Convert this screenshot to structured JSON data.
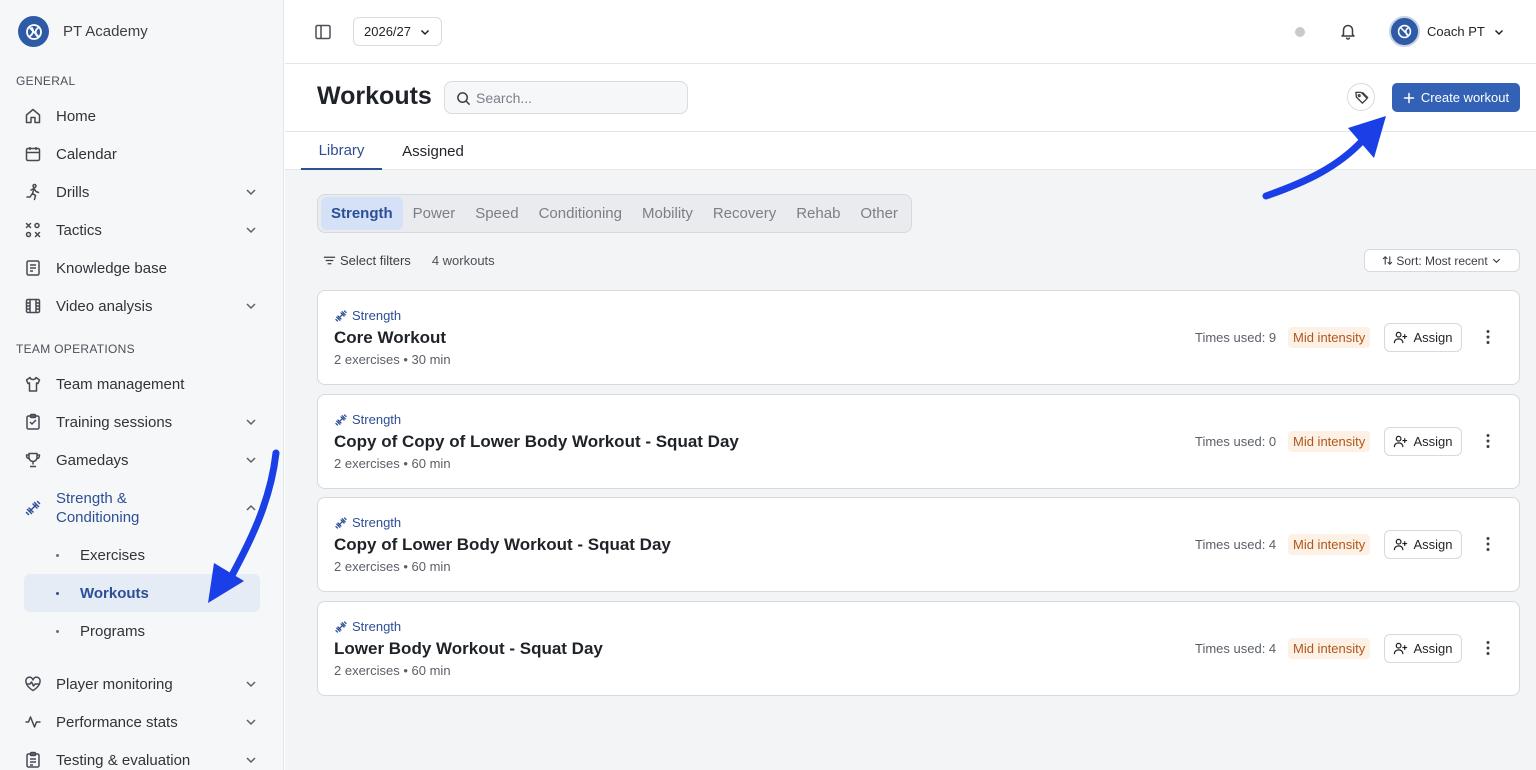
{
  "brand": {
    "name": "PT Academy"
  },
  "sidebar": {
    "general_label": "GENERAL",
    "general_items": [
      {
        "label": "Home",
        "icon": "home-icon"
      },
      {
        "label": "Calendar",
        "icon": "calendar-icon"
      },
      {
        "label": "Drills",
        "icon": "running-icon",
        "expandable": true
      },
      {
        "label": "Tactics",
        "icon": "tactics-icon",
        "expandable": true
      },
      {
        "label": "Knowledge base",
        "icon": "book-icon"
      },
      {
        "label": "Video analysis",
        "icon": "film-icon",
        "expandable": true
      }
    ],
    "team_label": "TEAM OPERATIONS",
    "team_items": [
      {
        "label": "Team management",
        "icon": "shirt-icon"
      },
      {
        "label": "Training sessions",
        "icon": "clipboard-icon",
        "expandable": true
      },
      {
        "label": "Gamedays",
        "icon": "trophy-icon",
        "expandable": true
      },
      {
        "label": "Strength & Conditioning",
        "icon": "dumbbell-icon",
        "expanded": true
      }
    ],
    "sc_sub_items": [
      {
        "label": "Exercises"
      },
      {
        "label": "Workouts",
        "active": true
      },
      {
        "label": "Programs"
      }
    ],
    "bottom_items": [
      {
        "label": "Player monitoring",
        "icon": "heart-pulse-icon",
        "expandable": true
      },
      {
        "label": "Performance stats",
        "icon": "activity-icon",
        "expandable": true
      },
      {
        "label": "Testing & evaluation",
        "icon": "clipboard-check-icon",
        "expandable": true
      }
    ]
  },
  "topbar": {
    "season": "2026/27",
    "user_name": "Coach PT"
  },
  "page": {
    "title": "Workouts",
    "search_placeholder": "Search...",
    "create_label": "Create workout"
  },
  "tabs": [
    {
      "label": "Library",
      "active": true
    },
    {
      "label": "Assigned",
      "active": false
    }
  ],
  "categories": [
    "Strength",
    "Power",
    "Speed",
    "Conditioning",
    "Mobility",
    "Recovery",
    "Rehab",
    "Other"
  ],
  "active_category": "Strength",
  "filters": {
    "label": "Select filters",
    "count": "4 workouts",
    "sort": "Sort: Most recent"
  },
  "workouts": [
    {
      "category": "Strength",
      "title": "Core Workout",
      "meta": "2 exercises • 30 min",
      "times_used": "Times used: 9",
      "intensity": "Mid intensity",
      "assign_label": "Assign"
    },
    {
      "category": "Strength",
      "title": "Copy of Copy of Lower Body Workout - Squat Day",
      "meta": "2 exercises • 60 min",
      "times_used": "Times used: 0",
      "intensity": "Mid intensity",
      "assign_label": "Assign"
    },
    {
      "category": "Strength",
      "title": "Copy of Lower Body Workout - Squat Day",
      "meta": "2 exercises • 60 min",
      "times_used": "Times used: 4",
      "intensity": "Mid intensity",
      "assign_label": "Assign"
    },
    {
      "category": "Strength",
      "title": "Lower Body Workout - Squat Day",
      "meta": "2 exercises • 60 min",
      "times_used": "Times used: 4",
      "intensity": "Mid intensity",
      "assign_label": "Assign"
    }
  ],
  "colors": {
    "accent": "#3261b5",
    "active_text": "#2d4f96",
    "intensity_bg": "#fdf1e6",
    "intensity_text": "#b0561a",
    "annotation_arrow": "#1a3fe6"
  }
}
